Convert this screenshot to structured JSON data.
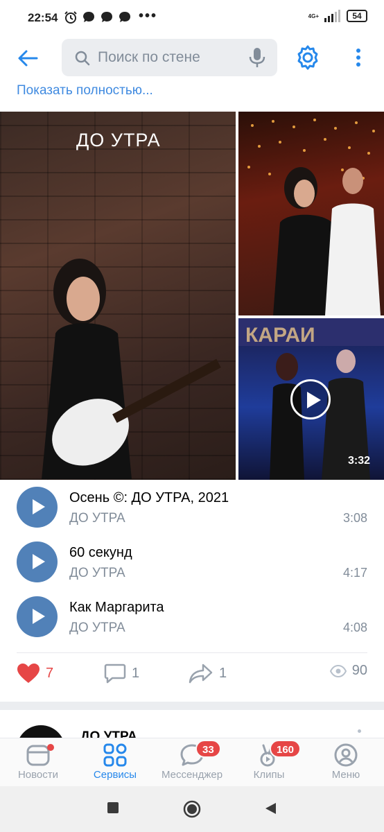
{
  "status_bar": {
    "time": "22:54",
    "dots": "•••",
    "network": "4G+",
    "battery": "54"
  },
  "header": {
    "search_placeholder": "Поиск по стене"
  },
  "post": {
    "show_full_label": "Показать полностью...",
    "photo_watermark": "ДО УТРА",
    "video_duration": "3:32",
    "tracks": [
      {
        "title": "Осень ©: ДО УТРА, 2021",
        "artist": "ДО УТРА",
        "duration": "3:08"
      },
      {
        "title": "60 секунд",
        "artist": "ДО УТРА",
        "duration": "4:17"
      },
      {
        "title": "Как Маргарита",
        "artist": "ДО УТРА",
        "duration": "4:08"
      }
    ],
    "likes": "7",
    "comments": "1",
    "shares": "1",
    "views": "90",
    "like_color": "#e64646"
  },
  "next_post": {
    "author": "ДО УТРА"
  },
  "bottom_nav": {
    "items": [
      {
        "label": "Новости",
        "icon": "news-icon"
      },
      {
        "label": "Сервисы",
        "icon": "services-icon",
        "active": true
      },
      {
        "label": "Мессенджер",
        "icon": "messenger-icon",
        "badge": "33"
      },
      {
        "label": "Клипы",
        "icon": "clips-icon",
        "badge": "160"
      },
      {
        "label": "Меню",
        "icon": "profile-icon"
      }
    ]
  },
  "colors": {
    "accent": "#2688eb",
    "badge": "#e64646",
    "play_button": "#5181b8",
    "secondary_text": "#818c99"
  }
}
